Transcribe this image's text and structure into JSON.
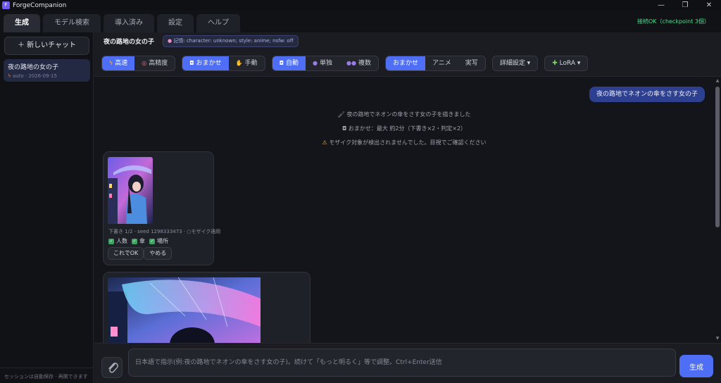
{
  "window": {
    "title": "ForgeCompanion",
    "minimize": "—",
    "restore": "❐",
    "close": "✕"
  },
  "tabs": [
    {
      "label": "生成"
    },
    {
      "label": "モデル検索"
    },
    {
      "label": "導入済み"
    },
    {
      "label": "設定"
    },
    {
      "label": "ヘルプ"
    }
  ],
  "connection_status": "接続OK（checkpoint 3個）",
  "sidebar": {
    "new_chat_label": "＋ 新しいチャット",
    "chats": [
      {
        "title": "夜の路地の女の子",
        "meta": "auto · 2026-09-15"
      }
    ],
    "footer": "セッションは自動保存 · 再開できます"
  },
  "chat_header": {
    "title": "夜の路地の女の子",
    "memory_badge": "記憶: character: unknown; style: anime; nsfw: off"
  },
  "toolbar": {
    "quality": [
      {
        "label": "高速",
        "active": true
      },
      {
        "label": "高精度",
        "active": false
      }
    ],
    "mode": [
      {
        "label": "おまかせ",
        "active": true
      },
      {
        "label": "手動",
        "active": false
      }
    ],
    "count": [
      {
        "label": "自動",
        "active": true
      },
      {
        "label": "単独",
        "active": false
      },
      {
        "label": "複数",
        "active": false
      }
    ],
    "style": [
      {
        "label": "おまかせ",
        "active": true
      },
      {
        "label": "アニメ",
        "active": false
      },
      {
        "label": "実写",
        "active": false
      }
    ],
    "details_label": "詳細設定 ▾",
    "lora_label": "LoRA ▾"
  },
  "messages": {
    "user": "夜の路地でネオンの傘をさす女の子",
    "sys1": "夜の路地でネオンの傘をさす女の子を描きました",
    "sys2": "おまかせ：最大 約2分（下書き×2・判定×2）",
    "sys3": "モザイク対象が検出されませんでした。目視でご確認ください",
    "card1": {
      "meta": "下書き 1/2 · seed 1298333473 · ○モザイク適用",
      "checks": [
        "人数",
        "傘",
        "場所"
      ],
      "ok_label": "これでOK",
      "cancel_label": "やめる"
    }
  },
  "input": {
    "placeholder": "日本語で指示(例:夜の路地でネオンの傘をさす女の子)。続けて「もっと明るく」等で調整。Ctrl+Enter送信",
    "generate_label": "生成"
  },
  "colors": {
    "accent": "#4d6ef5",
    "status_ok": "#4fdc8f",
    "user_bubble": "#2d3f8f"
  }
}
